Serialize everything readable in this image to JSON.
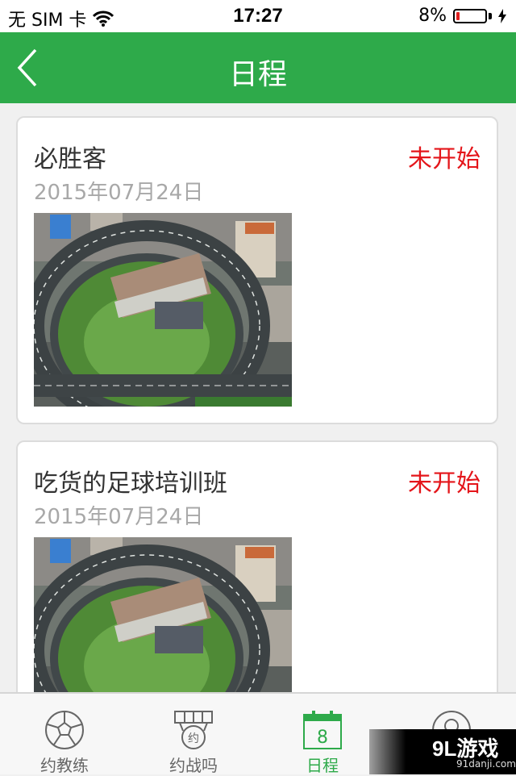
{
  "status_bar": {
    "carrier": "无 SIM 卡",
    "time": "17:27",
    "battery": "8%",
    "battery_level": 0.08
  },
  "nav": {
    "title": "日程",
    "back_icon": "chevron-left-icon"
  },
  "schedule": [
    {
      "title": "必胜客",
      "status": "未开始",
      "date": "2015年07月24日",
      "image": "aerial-interchange-photo"
    },
    {
      "title": "吃货的足球培训班",
      "status": "未开始",
      "date": "2015年07月24日",
      "image": "aerial-interchange-photo"
    }
  ],
  "tabs": [
    {
      "label": "约教练",
      "icon": "soccer-ball-icon",
      "active": false
    },
    {
      "label": "约战吗",
      "icon": "medal-icon",
      "active": false
    },
    {
      "label": "日程",
      "icon": "calendar-icon",
      "calendar_day": "8",
      "active": true
    },
    {
      "label": "",
      "icon": "user-icon",
      "active": false
    }
  ],
  "watermark": {
    "main": "9L游戏",
    "sub": "91danji.com"
  },
  "colors": {
    "primary": "#2eaa4a",
    "status_red": "#e4151a",
    "date_gray": "#a8a8a8"
  }
}
